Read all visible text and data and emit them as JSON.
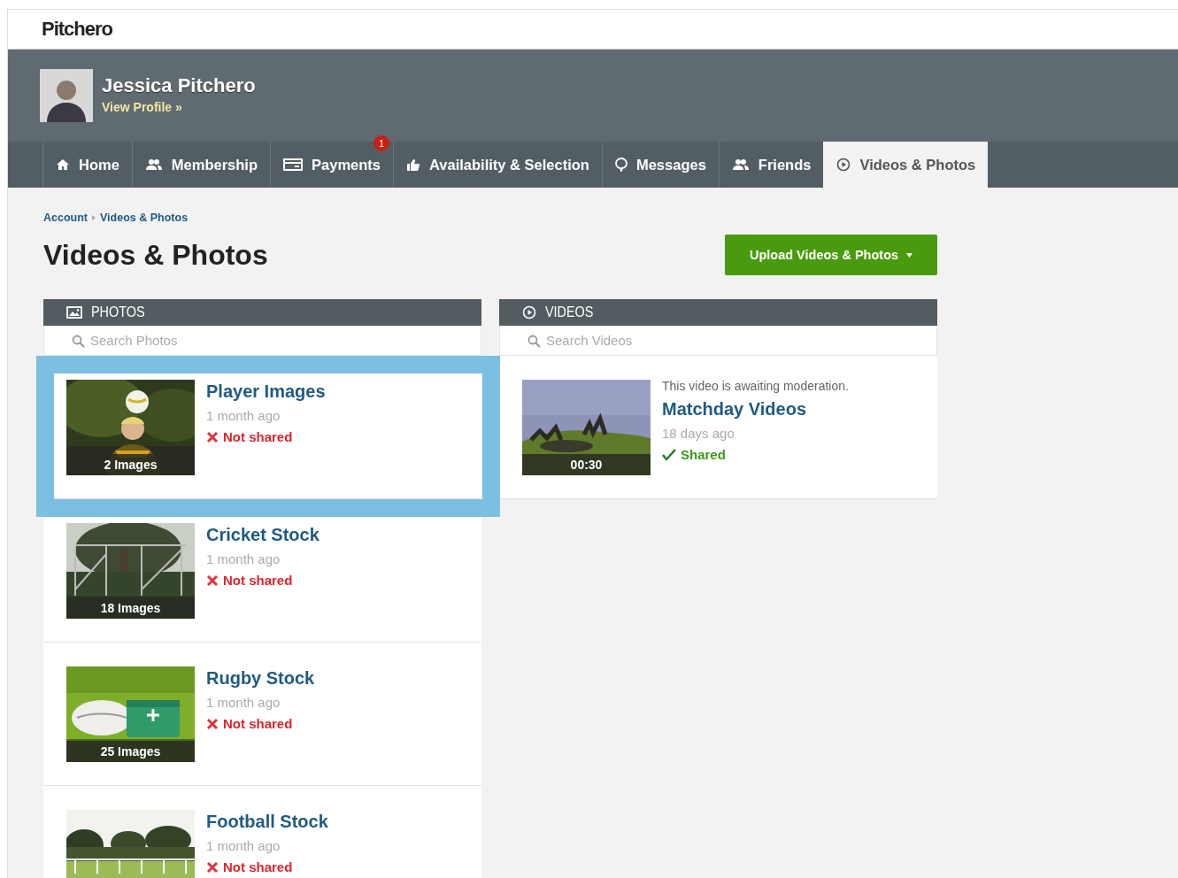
{
  "brand": {
    "logo": "Pitchero"
  },
  "profile": {
    "name": "Jessica Pitchero",
    "link": "View Profile »"
  },
  "nav": [
    {
      "label": "Home",
      "selected": false
    },
    {
      "label": "Membership",
      "selected": false
    },
    {
      "label": "Payments",
      "selected": false,
      "badge": "1"
    },
    {
      "label": "Availability & Selection",
      "selected": false
    },
    {
      "label": "Messages",
      "selected": false
    },
    {
      "label": "Friends",
      "selected": false
    },
    {
      "label": "Videos & Photos",
      "selected": true
    }
  ],
  "breadcrumb": [
    "Account",
    "Videos & Photos"
  ],
  "page_title": "Videos & Photos",
  "upload_button": {
    "label": "Upload Videos & Photos"
  },
  "photos": {
    "title": "PHOTOS",
    "search": {
      "placeholder": "Search Photos"
    },
    "items": [
      {
        "title": "Player Images",
        "date": "1 month ago",
        "count": "2 Images",
        "status": "Not shared",
        "shared": false,
        "highlighted": true
      },
      {
        "title": "Cricket Stock",
        "date": "1 month ago",
        "count": "18 Images",
        "status": "Not shared",
        "shared": false,
        "highlighted": false
      },
      {
        "title": "Rugby Stock",
        "date": "1 month ago",
        "count": "25 Images",
        "status": "Not shared",
        "shared": false,
        "highlighted": false
      },
      {
        "title": "Football Stock",
        "date": "1 month ago",
        "status": "Not shared",
        "shared": false,
        "highlighted": false
      }
    ]
  },
  "videos": {
    "title": "VIDEOS",
    "search": {
      "placeholder": "Search Videos"
    },
    "items": [
      {
        "notice": "This video is awaiting moderation.",
        "title": "Matchday Videos",
        "date": "18 days ago",
        "count": "00:30",
        "status": "Shared",
        "shared": true,
        "highlighted": false
      }
    ]
  }
}
